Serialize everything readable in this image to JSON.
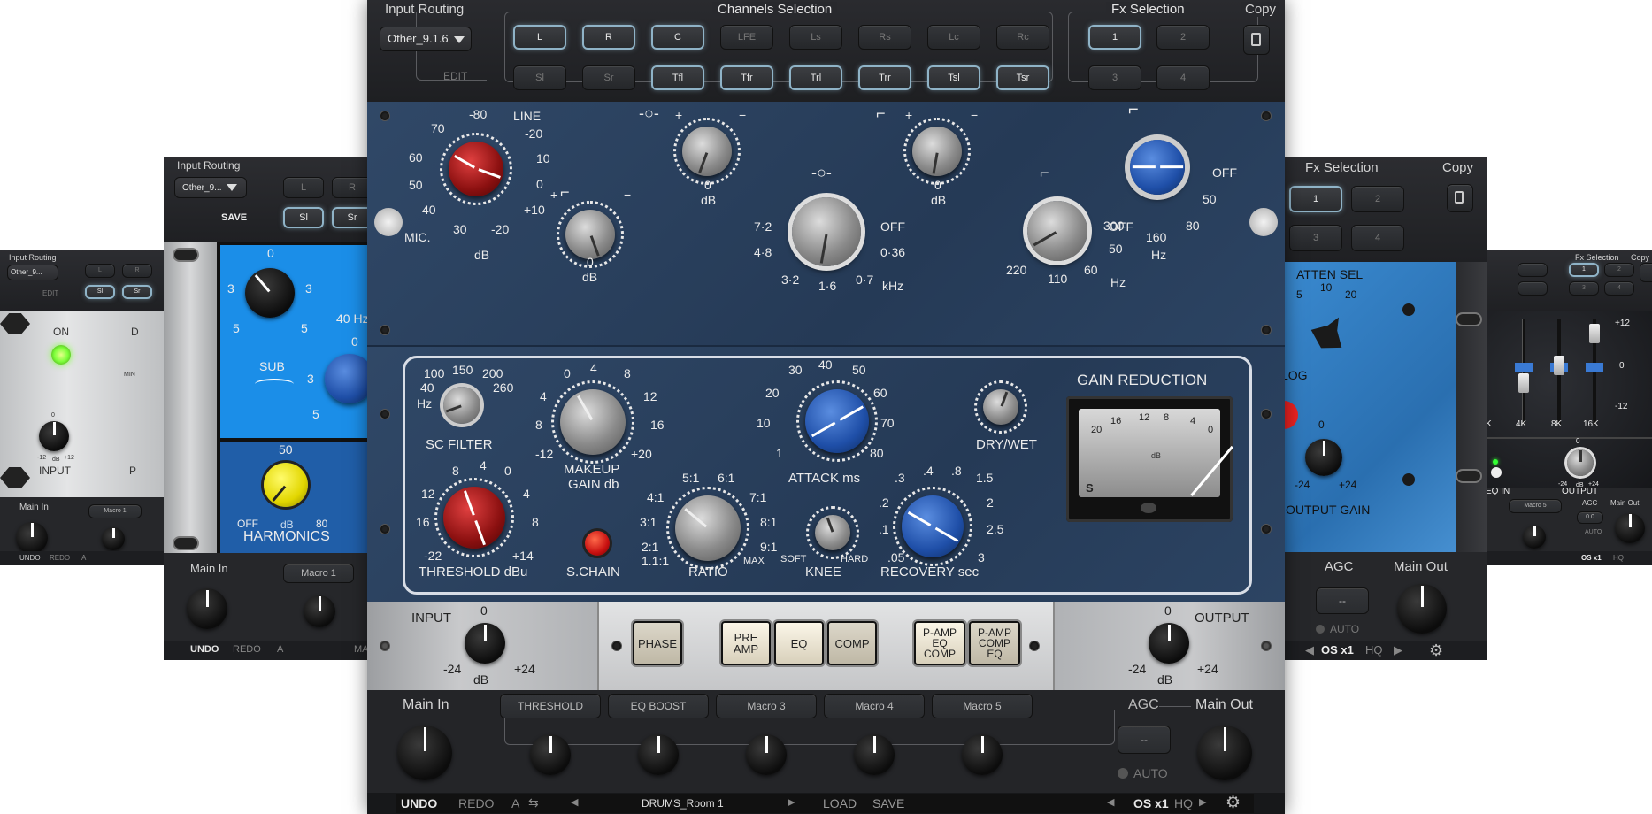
{
  "left_far": {
    "input_routing": "Input Routing",
    "routing_value": "Other_9...",
    "edit": "EDIT",
    "on": "ON",
    "input": "INPUT",
    "zero": "0",
    "minus12": "-12",
    "plus12": "+12",
    "db": "dB",
    "main_in": "Main In",
    "macro1": "Macro 1",
    "undo": "UNDO",
    "redo": "REDO",
    "a": "A",
    "d": "D",
    "min": "MIN",
    "p": "P"
  },
  "left_mid": {
    "input_routing": "Input Routing",
    "routing_value": "Other_9...",
    "save": "SAVE",
    "ch_l": "L",
    "ch_r": "R",
    "ch_sl": "Sl",
    "ch_sr": "Sr",
    "zero": "0",
    "three": "3",
    "five": "5",
    "sub": "SUB",
    "hz40": "40 Hz",
    "fifty": "50",
    "off": "OFF",
    "db": "dB",
    "eighty": "80",
    "harmonics": "HARMONICS",
    "main_in": "Main In",
    "macro1": "Macro 1",
    "undo": "UNDO",
    "redo": "REDO",
    "a": "A",
    "ma": "MA"
  },
  "right_mid": {
    "fx_selection": "Fx Selection",
    "copy": "Copy",
    "fx1": "1",
    "fx2": "2",
    "fx3": "3",
    "fx4": "4",
    "atten_sel": "ATTEN SEL",
    "t5": "5",
    "t10": "10",
    "t20": "20",
    "log": "LOG",
    "zero": "0",
    "minus24": "-24",
    "plus24": "+24",
    "output_gain": "OUTPUT GAIN",
    "agc": "AGC",
    "main_out": "Main Out",
    "agc_val": "--",
    "auto": "AUTO",
    "os": "OS x1",
    "hq": "HQ"
  },
  "right_far": {
    "fx_selection": "Fx Selection",
    "copy": "Copy",
    "fx1": "1",
    "fx2": "2",
    "fx3": "3",
    "fx4": "4",
    "plus12": "+12",
    "zero": "0",
    "minus12": "-12",
    "k4": "4K",
    "k8": "8K",
    "k16": "16K",
    "k": "K",
    "eq_in": "EQ IN",
    "output": "OUTPUT",
    "out0": "0",
    "out_m24": "-24",
    "out_db": "dB",
    "out_p24": "+24",
    "macro5": "Macro 5",
    "agc": "AGC",
    "main_out": "Main Out",
    "agc_val": "0.0",
    "auto": "AUTO",
    "os": "OS x1",
    "hq": "HQ"
  },
  "main": {
    "input_routing": "Input Routing",
    "routing_value": "Other_9.1.6",
    "edit": "EDIT",
    "channels_selection": "Channels Selection",
    "channels": [
      {
        "label": "L",
        "on": true
      },
      {
        "label": "R",
        "on": true
      },
      {
        "label": "C",
        "on": true
      },
      {
        "label": "LFE",
        "on": false
      },
      {
        "label": "Ls",
        "on": false
      },
      {
        "label": "Rs",
        "on": false
      },
      {
        "label": "Lc",
        "on": false
      },
      {
        "label": "Rc",
        "on": false
      },
      {
        "label": "Sl",
        "on": false
      },
      {
        "label": "Sr",
        "on": false
      },
      {
        "label": "Tfl",
        "on": true
      },
      {
        "label": "Tfr",
        "on": true
      },
      {
        "label": "Trl",
        "on": true
      },
      {
        "label": "Trr",
        "on": true
      },
      {
        "label": "Tsl",
        "on": true
      },
      {
        "label": "Tsr",
        "on": true
      }
    ],
    "fx_selection": "Fx Selection",
    "fx": [
      "1",
      "2",
      "3",
      "4"
    ],
    "copy": "Copy",
    "pre": {
      "mic": "MIC.",
      "line": "LINE",
      "t80": "-80",
      "t70": "70",
      "t60": "60",
      "t50": "50",
      "t40": "40",
      "t30": "30",
      "t20": "-20",
      "db": "dB",
      "r20": "-20",
      "r10": "10",
      "r0": "0",
      "r_10": "+10",
      "r_20": "-20"
    },
    "eq": {
      "plus": "+",
      "minus": "−",
      "db": "dB",
      "zero": "0",
      "f72": "7·2",
      "f48": "4·8",
      "f32": "3·2",
      "f16": "1·6",
      "f07": "0·7",
      "f036": "0·36",
      "off": "OFF",
      "khz": "kHz",
      "h220": "220",
      "h110": "110",
      "h60": "60",
      "h50": "50",
      "hz": "Hz",
      "lp300": "300",
      "lp160": "160",
      "lp80": "80",
      "lp50": "50",
      "lpoff": "OFF"
    },
    "comp": {
      "sc_filter": "SC FILTER",
      "hz": "Hz",
      "sc100": "100",
      "sc150": "150",
      "sc200": "200",
      "sc40": "40",
      "sc260": "260",
      "makeup": "MAKEUP",
      "gain_db": "GAIN db",
      "m0": "0",
      "m4": "4",
      "m8": "8",
      "m12": "12",
      "m16": "16",
      "m_12": "-12",
      "m_20": "+20",
      "mm4": "4",
      "mm8": "8",
      "attack": "ATTACK ms",
      "a30": "30",
      "a40": "40",
      "a50": "50",
      "a20": "20",
      "a60": "60",
      "a10": "10",
      "a70": "70",
      "a1": "1",
      "a80": "80",
      "drywet": "DRY/WET",
      "gr": "GAIN REDUCTION",
      "threshold": "THRESHOLD dBu",
      "t8": "8",
      "t4": "4",
      "t0": "0",
      "t12": "12",
      "t16": "16",
      "t_4": "4",
      "t_8": "8",
      "t_22": "-22",
      "t_14": "+14",
      "schain": "S.CHAIN",
      "ratio": "RATIO",
      "r51": "5:1",
      "r61": "6:1",
      "r31": "3:1",
      "r71": "7:1",
      "r41": "4:1",
      "r81": "8:1",
      "r21": "2:1",
      "r91": "9:1",
      "r111": "1.1:1",
      "rmax": "MAX",
      "knee": "KNEE",
      "soft": "SOFT",
      "hard": "HARD",
      "recovery": "RECOVERY sec",
      "c3": ".3",
      "c4": ".4",
      "c8": ".8",
      "c15": "1.5",
      "c2": ".2",
      "c_2": "2",
      "c1": ".1",
      "c25": "2.5",
      "c05": ".05",
      "c_3": "3",
      "vu": [
        "20",
        "16",
        "12",
        "8",
        "4",
        "0"
      ],
      "vu_db": "dB",
      "vu_s": "S"
    },
    "io": {
      "input": "INPUT",
      "output": "OUTPUT",
      "zero": "0",
      "m24": "-24",
      "db": "dB",
      "p24": "+24"
    },
    "buttons": {
      "phase": "PHASE",
      "preamp": "PRE AMP",
      "eq": "EQ",
      "comp": "COMP",
      "pampeqcomp": "P-AMP EQ COMP",
      "pampcompeq": "P-AMP COMP EQ"
    },
    "bottom": {
      "main_in": "Main In",
      "macros": [
        "THRESHOLD",
        "EQ BOOST",
        "Macro 3",
        "Macro 4",
        "Macro 5"
      ],
      "agc": "AGC",
      "main_out": "Main Out",
      "agc_val": "--",
      "auto": "AUTO"
    },
    "footer": {
      "undo": "UNDO",
      "redo": "REDO",
      "a": "A",
      "preset": "DRUMS_Room 1",
      "load": "LOAD",
      "save": "SAVE",
      "os": "OS x1",
      "hq": "HQ"
    }
  },
  "colors": {
    "panel_blue": "#2c4463",
    "active_border": "#8fb3c7",
    "knob_red": "#b31b1b",
    "knob_blue": "#2a5cbf",
    "led_red": "#e02020",
    "led_green": "#7dff3a"
  }
}
